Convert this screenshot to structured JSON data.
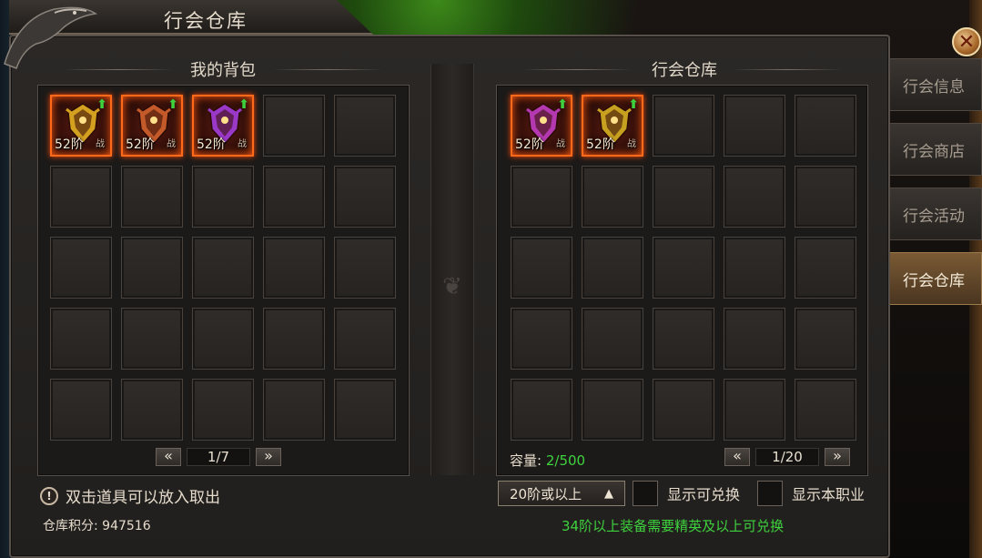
{
  "window": {
    "title": "行会仓库"
  },
  "backpack": {
    "title": "我的背包",
    "items": [
      {
        "level": "52阶",
        "cls": "战",
        "color": "#d4a020"
      },
      {
        "level": "52阶",
        "cls": "战",
        "color": "#c45a2a"
      },
      {
        "level": "52阶",
        "cls": "战",
        "color": "#9a38c8"
      }
    ],
    "page": "1/7"
  },
  "warehouse": {
    "title": "行会仓库",
    "items": [
      {
        "level": "52阶",
        "cls": "战",
        "color": "#b438b0"
      },
      {
        "level": "52阶",
        "cls": "战",
        "color": "#c8a020"
      }
    ],
    "page": "1/20",
    "capacity_label": "容量:",
    "capacity_value": "2/500"
  },
  "tabs": [
    "行会信息",
    "行会商店",
    "行会活动",
    "行会仓库"
  ],
  "footer": {
    "hint": "双击道具可以放入取出",
    "score_label": "仓库积分:",
    "score_value": "947516",
    "filter_value": "20阶或以上",
    "check_exchange": "显示可兑换",
    "check_class": "显示本职业",
    "notice": "34阶以上装备需要精英及以上可兑换"
  },
  "glyphs": {
    "prev": "«",
    "next": "»",
    "up": "▲",
    "close": "✕",
    "hint": "!",
    "arrow": "⬆"
  }
}
